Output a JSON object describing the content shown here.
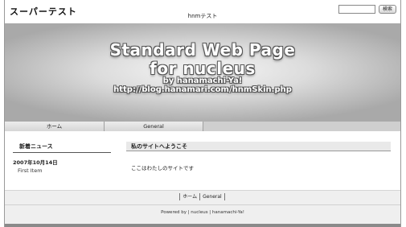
{
  "header": {
    "site_title": "スーパーテスト",
    "site_subtitle": "hnmテスト",
    "search_placeholder": "",
    "search_button": "検索"
  },
  "banner": {
    "line1": "Standard Web Page",
    "line2": "for nucleus",
    "line3": "by hanamachi-Ya!",
    "line4": "http://blog.hanamari.com/hnmSkin.php"
  },
  "nav": {
    "items": [
      {
        "label": "ホーム"
      },
      {
        "label": "General"
      }
    ]
  },
  "sidebar": {
    "title": "新着ニュース",
    "date": "2007年10月14日",
    "item": "First Item"
  },
  "main": {
    "title": "私のサイトへようこそ",
    "body": "ここはわたしのサイトです"
  },
  "footer": {
    "links": [
      {
        "label": "ホーム"
      },
      {
        "label": "General"
      }
    ],
    "credit": "Powered by | nucleus | hanamachi-Ya!"
  }
}
